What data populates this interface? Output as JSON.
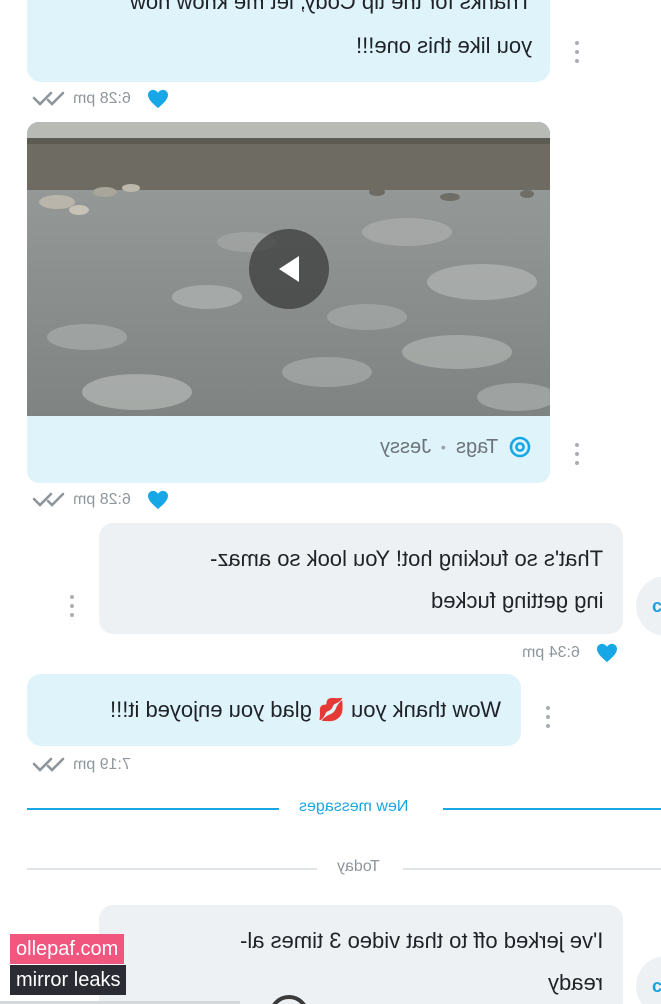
{
  "colors": {
    "accent": "#18a7e6",
    "received_bubble": "#dff3fb",
    "sent_bubble": "#eef1f4",
    "meta_text": "#8e969c",
    "watermark_pink": "#f0567e",
    "watermark_dark": "#2b2b33"
  },
  "messages": [
    {
      "id": "m1",
      "direction": "received",
      "lines": [
        "Thanks for the tip Cody, let me know how",
        "you like this one!!!"
      ],
      "time": "6:28 pm",
      "liked": true
    },
    {
      "id": "m2",
      "direction": "received",
      "type": "video",
      "tags_label": "Tags",
      "tag_user": "Jessy",
      "separator": "•",
      "time": "6:28 pm",
      "liked": true
    },
    {
      "id": "m3",
      "direction": "sent",
      "lines": [
        "That's so fucking hot! You look so amaz-",
        "ing getting fucked"
      ],
      "time": "6:34 pm",
      "liked": true
    },
    {
      "id": "m4",
      "direction": "received",
      "text_before": "Wow thank you",
      "emoji": "💋",
      "text_after": "glad you enjoyed it!!!",
      "time": "7:19 pm",
      "liked": false
    },
    {
      "id": "m5",
      "direction": "sent",
      "lines": [
        "I've jerked off to that video 3 times al-",
        "ready"
      ]
    }
  ],
  "dividers": {
    "new_messages": "New messages",
    "today": "Today"
  },
  "avatar_letter": "c",
  "watermarks": [
    "ollepaf.com",
    "mirror leaks"
  ],
  "icons": {
    "more": "kebab-menu-icon",
    "like": "heart-icon",
    "read": "double-check-icon",
    "play": "play-icon",
    "tag": "at-sign-icon"
  }
}
